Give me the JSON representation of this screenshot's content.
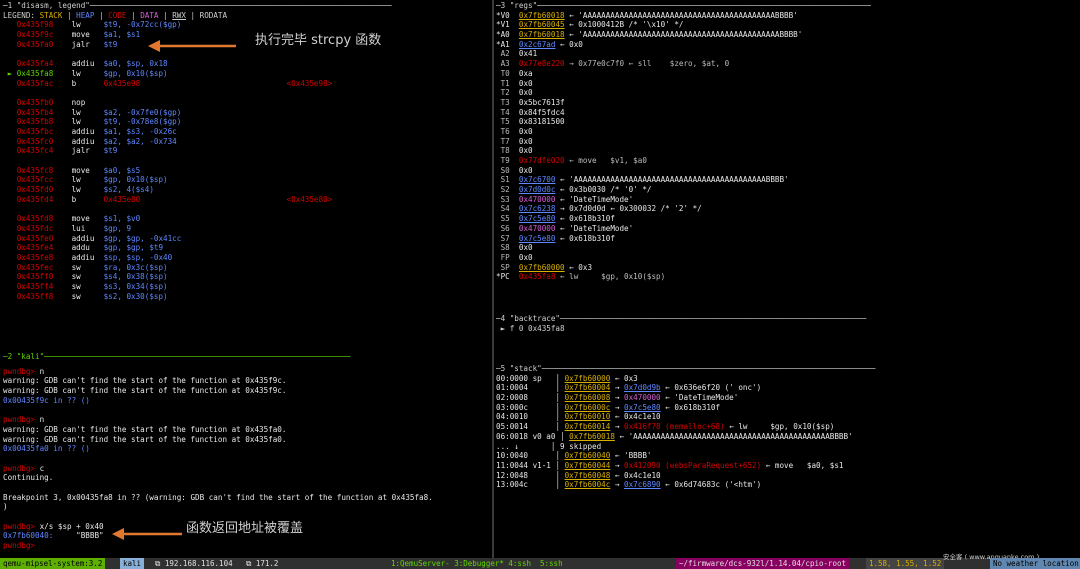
{
  "colors": {
    "background": "#000000",
    "yellow": "#d7af00",
    "green": "#5fd700",
    "blue": "#5f87ff",
    "red": "#d70000",
    "status_green": "#5faf00",
    "status_magenta": "#87005f"
  },
  "disasm": {
    "title": "─1 \"disasm, legend\"──────────────────────────────────────────────────────────────────",
    "legend": {
      "prefix": "LEGEND: ",
      "stack": "STACK",
      "heap": "HEAP",
      "code": "CODE",
      "data": "DATA",
      "rwx": "RWX",
      "rodata": "RODATA"
    },
    "lines": [
      {
        "addr": "0x435f98",
        "op": "lw",
        "args": "$t9, -0x72cc($gp)",
        "target": ""
      },
      {
        "addr": "0x435f9c",
        "op": "move",
        "args": "$a1, $s1",
        "target": ""
      },
      {
        "addr": "0x435fa0",
        "op": "jalr",
        "args": "$t9",
        "target": ""
      },
      {
        "addr": "",
        "op": "",
        "args": "",
        "target": ""
      },
      {
        "addr": "0x435fa4",
        "op": "addiu",
        "args": "$a0, $sp, 0x18",
        "target": ""
      },
      {
        "addr": "0x435fa8",
        "op": "lw",
        "args": "$gp, 0x10($sp)",
        "target": "",
        "current": true
      },
      {
        "addr": "0x435fac",
        "op": "b",
        "args": "0x435e98",
        "target": "<0x435e98>",
        "red": true
      },
      {
        "addr": "",
        "op": "",
        "args": "",
        "target": ""
      },
      {
        "addr": "0x435fb0",
        "op": "nop",
        "args": "",
        "target": ""
      },
      {
        "addr": "0x435fb4",
        "op": "lw",
        "args": "$a2, -0x7fe0($gp)",
        "target": ""
      },
      {
        "addr": "0x435fb8",
        "op": "lw",
        "args": "$t9, -0x78e8($gp)",
        "target": ""
      },
      {
        "addr": "0x435fbc",
        "op": "addiu",
        "args": "$a1, $s3, -0x26c",
        "target": ""
      },
      {
        "addr": "0x435fc0",
        "op": "addiu",
        "args": "$a2, $a2, -0x734",
        "target": ""
      },
      {
        "addr": "0x435fc4",
        "op": "jalr",
        "args": "$t9",
        "target": ""
      },
      {
        "addr": "",
        "op": "",
        "args": "",
        "target": ""
      },
      {
        "addr": "0x435fc8",
        "op": "move",
        "args": "$a0, $s5",
        "target": ""
      },
      {
        "addr": "0x435fcc",
        "op": "lw",
        "args": "$gp, 0x10($sp)",
        "target": ""
      },
      {
        "addr": "0x435fd0",
        "op": "lw",
        "args": "$s2, 4($s4)",
        "target": ""
      },
      {
        "addr": "0x435fd4",
        "op": "b",
        "args": "0x435e80",
        "target": "<0x435e80>",
        "red": true
      },
      {
        "addr": "",
        "op": "",
        "args": "",
        "target": ""
      },
      {
        "addr": "0x435fd8",
        "op": "move",
        "args": "$s1, $v0",
        "target": ""
      },
      {
        "addr": "0x435fdc",
        "op": "lui",
        "args": "$gp, 9",
        "target": ""
      },
      {
        "addr": "0x435fe0",
        "op": "addiu",
        "args": "$gp, $gp, -0x41cc",
        "target": ""
      },
      {
        "addr": "0x435fe4",
        "op": "addu",
        "args": "$gp, $gp, $t9",
        "target": ""
      },
      {
        "addr": "0x435fe8",
        "op": "addiu",
        "args": "$sp, $sp, -0x40",
        "target": ""
      },
      {
        "addr": "0x435fec",
        "op": "sw",
        "args": "$ra, 0x3c($sp)",
        "target": ""
      },
      {
        "addr": "0x435ff0",
        "op": "sw",
        "args": "$s4, 0x38($sp)",
        "target": ""
      },
      {
        "addr": "0x435ff4",
        "op": "sw",
        "args": "$s3, 0x34($sp)",
        "target": ""
      },
      {
        "addr": "0x435ff8",
        "op": "sw",
        "args": "$s2, 0x30($sp)",
        "target": ""
      }
    ],
    "annotation": "执行完毕 strcpy 函数"
  },
  "regs": {
    "title": "─3 \"regs\"─────────────────────────────────────────────────────────────────────────",
    "lines": [
      {
        "name": "*V0",
        "val": "0x7fb60018",
        "rest": " ← 'AAAAAAAAAAAAAAAAAAAAAAAAAAAAAAAAAAAAAAAAAABBBB'",
        "style": "stack"
      },
      {
        "name": "*V1",
        "val": "0x7fb60045",
        "rest": " ← 0x1000412B /* '\\x10' */",
        "style": "stack"
      },
      {
        "name": "*A0",
        "val": "0x7fb60018",
        "rest": " ← 'AAAAAAAAAAAAAAAAAAAAAAAAAAAAAAAAAAAAAAAAAAABBBB'",
        "style": "stack"
      },
      {
        "name": "*A1",
        "val": "0x2c67ad",
        "rest": " ← 0x0",
        "style": "heap"
      },
      {
        "name": "A2",
        "val": "0x41",
        "rest": "",
        "style": "plain"
      },
      {
        "name": "A3",
        "val": "0x77e8e220",
        "rest": " → 0x77e0c7f0 ← sll    $zero, $at, 0",
        "style": "red"
      },
      {
        "name": "T0",
        "val": "0xa",
        "rest": "",
        "style": "plain"
      },
      {
        "name": "T1",
        "val": "0x0",
        "rest": "",
        "style": "plain"
      },
      {
        "name": "T2",
        "val": "0x0",
        "rest": "",
        "style": "plain"
      },
      {
        "name": "T3",
        "val": "0x5bc7613f",
        "rest": "",
        "style": "plain"
      },
      {
        "name": "T4",
        "val": "0x84f5fdc4",
        "rest": "",
        "style": "plain"
      },
      {
        "name": "T5",
        "val": "0x83181500",
        "rest": "",
        "style": "plain"
      },
      {
        "name": "T6",
        "val": "0x0",
        "rest": "",
        "style": "plain"
      },
      {
        "name": "T7",
        "val": "0x0",
        "rest": "",
        "style": "plain"
      },
      {
        "name": "T8",
        "val": "0x0",
        "rest": "",
        "style": "plain"
      },
      {
        "name": "T9",
        "val": "0x77dfe020",
        "rest": " ← move   $v1, $a0",
        "style": "red"
      },
      {
        "name": "S0",
        "val": "0x0",
        "rest": "",
        "style": "plain"
      },
      {
        "name": "S1",
        "val": "0x7c6700",
        "rest": " ← 'AAAAAAAAAAAAAAAAAAAAAAAAAAAAAAAAAAAAAAAAAABBBB'",
        "style": "heap"
      },
      {
        "name": "S2",
        "val": "0x7d0d0c",
        "rest": " ← 0x3b0030 /* '0' */",
        "style": "heap"
      },
      {
        "name": "S3",
        "val": "0x470000",
        "rest": " ← 'DateTimeMode'",
        "style": "data"
      },
      {
        "name": "S4",
        "val": "0x7c6238",
        "rest": " → 0x7d0d0d ← 0x300032 /* '2' */",
        "style": "heap"
      },
      {
        "name": "S5",
        "val": "0x7c5e80",
        "rest": " ← 0x618b310f",
        "style": "heap"
      },
      {
        "name": "S6",
        "val": "0x470000",
        "rest": " ← 'DateTimeMode'",
        "style": "data"
      },
      {
        "name": "S7",
        "val": "0x7c5e80",
        "rest": " ← 0x618b310f",
        "style": "heap"
      },
      {
        "name": "S8",
        "val": "0x0",
        "rest": "",
        "style": "plain"
      },
      {
        "name": "FP",
        "val": "0x0",
        "rest": "",
        "style": "plain"
      },
      {
        "name": "SP",
        "val": "0x7fb60000",
        "rest": " ← 0x3",
        "style": "stack"
      },
      {
        "name": "*PC",
        "val": "0x435fa8",
        "rest": " ← lw     $gp, 0x10($sp)",
        "style": "red"
      }
    ]
  },
  "backtrace": {
    "title": "─4 \"backtrace\"───────────────────────────────────────────────────────────────────",
    "line": " ► f 0 0x435fa8"
  },
  "stack": {
    "title": "─5 \"stack\"─────────────────────────────────────────────────────────────────────────",
    "lines": [
      {
        "off": "00:0000",
        "reg": "sp  ",
        "addr": "0x7fb60000",
        "rest": " ← 0x3",
        "rs": ""
      },
      {
        "off": "01:0004",
        "reg": "    ",
        "addr": "0x7fb60004",
        "rest": " ← 0x636e6f20 (' onc')",
        "arrow": "0x7d0d9b"
      },
      {
        "off": "02:0008",
        "reg": "    ",
        "addr": "0x7fb60008",
        "rest": " ← 'DateTimeMode'",
        "arrow": "0x470000"
      },
      {
        "off": "03:000c",
        "reg": "    ",
        "addr": "0x7fb6000c",
        "rest": " ← 0x618b310f",
        "arrow": "0x7c5e80"
      },
      {
        "off": "04:0010",
        "reg": "    ",
        "addr": "0x7fb60010",
        "rest": " ← 0x4c1e10",
        "arrow": ""
      },
      {
        "off": "05:0014",
        "reg": "    ",
        "addr": "0x7fb60014",
        "rest": " ← lw     $gp, 0x10($sp)",
        "arrow": "0x416f78 (memalloc+68)"
      },
      {
        "off": "06:0018",
        "reg": "v0 a0",
        "addr": "0x7fb60018",
        "rest": " ← 'AAAAAAAAAAAAAAAAAAAAAAAAAAAAAAAAAAAAAAAAAAABBBB'",
        "arrow": ""
      },
      {
        "off": "... ↓",
        "reg": "     ",
        "addr": "",
        "rest": "9 skipped",
        "arrow": ""
      },
      {
        "off": "10:0040",
        "reg": "    ",
        "addr": "0x7fb60040",
        "rest": " ← 'BBBB'",
        "arrow": ""
      },
      {
        "off": "11:0044",
        "reg": "v1-1",
        "addr": "0x7fb60044",
        "rest": " ← move   $a0, $s1",
        "arrow": "0x412090 (websParaRequest+652)"
      },
      {
        "off": "12:0048",
        "reg": "    ",
        "addr": "0x7fb60048",
        "rest": " ← 0x4c1e10",
        "arrow": ""
      },
      {
        "off": "13:004c",
        "reg": "    ",
        "addr": "0x7fb6004c",
        "rest": " ← 0x6d74683c ('<htm')",
        "arrow": "0x7c6890"
      }
    ]
  },
  "kali": {
    "title": "─2 \"kali\"───────────────────────────────────────────────────────────────────",
    "lines": [
      {
        "t": "pwndbg> n",
        "c": "prompt"
      },
      {
        "t": "warning: GDB can't find the start of the function at 0x435f9c.",
        "c": "plain"
      },
      {
        "t": "warning: GDB can't find the start of the function at 0x435f9c.",
        "c": "plain"
      },
      {
        "t": "0x00435f9c in ?? ()",
        "c": "addr"
      },
      {
        "t": "",
        "c": "plain"
      },
      {
        "t": "pwndbg> n",
        "c": "prompt"
      },
      {
        "t": "warning: GDB can't find the start of the function at 0x435fa0.",
        "c": "plain"
      },
      {
        "t": "warning: GDB can't find the start of the function at 0x435fa0.",
        "c": "plain"
      },
      {
        "t": "0x00435fa0 in ?? ()",
        "c": "addr"
      },
      {
        "t": "",
        "c": "plain"
      },
      {
        "t": "pwndbg> c",
        "c": "prompt"
      },
      {
        "t": "Continuing.",
        "c": "plain"
      },
      {
        "t": "",
        "c": "plain"
      },
      {
        "t": "Breakpoint 3, 0x00435fa8 in ?? (warning: GDB can't find the start of the function at 0x435fa8.",
        "c": "bp"
      },
      {
        "t": ")",
        "c": "plain"
      },
      {
        "t": "",
        "c": "plain"
      },
      {
        "t": "pwndbg> x/s $sp + 0x40",
        "c": "prompt"
      },
      {
        "t": "0x7fb60040:     \"BBBB\"",
        "c": "mem"
      },
      {
        "t": "pwndbg> ",
        "c": "prompt"
      }
    ],
    "annotation": "函数返回地址被覆盖"
  },
  "statusbar": {
    "session": "qemu-mipsel-system:3.2",
    "window": "kali",
    "ip": "⧉ 192.168.116.104",
    "ip2": "⧉ 171.2",
    "windows": "1:QemuServer- 3:Debugger* 4:ssh  5:ssh",
    "path": "~/firmware/dcs-932l/1.14.04/cpio-root",
    "load": "1.58, 1.55, 1.52",
    "weather": "No weather location",
    "watermark": "安全客 ( www.anquanke.com )"
  }
}
